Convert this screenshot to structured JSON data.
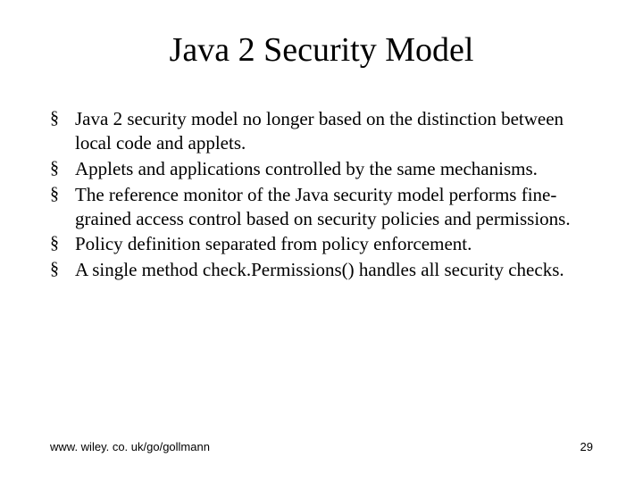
{
  "title": "Java 2 Security Model",
  "bullets": [
    "Java 2 security model no longer based on the distinction between local code and applets.",
    "Applets and applications controlled by the same mechanisms.",
    "The reference monitor of the Java security model performs fine-grained access control based on security policies and permissions.",
    "Policy definition separated from policy enforcement.",
    "A single method check.Permissions() handles all security checks."
  ],
  "footer": {
    "url": "www. wiley. co. uk/go/gollmann",
    "page": "29"
  }
}
